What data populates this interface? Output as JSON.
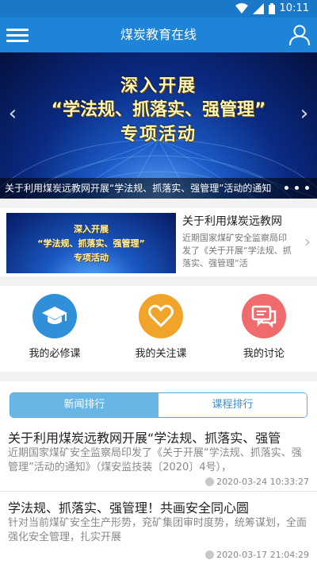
{
  "status": {
    "time": "10:11",
    "icons": [
      "wifi-icon",
      "signal-icon",
      "battery-icon"
    ]
  },
  "appbar": {
    "title": "煤炭教育在线",
    "menu_icon": "menu-icon",
    "user_icon": "user-icon"
  },
  "banner": {
    "line1": "深入开展",
    "line2": "“学法规、抓落实、强管理”",
    "line3": "专项活动",
    "caption": "关于利用煤炭远教网开展“学法规、抓落实、强管理”活动的通知",
    "prev_icon": "‹",
    "next_icon": "›"
  },
  "feature": {
    "thumb_line1": "深入开展",
    "thumb_line2": "“学法规、抓落实、强管理”",
    "thumb_line3": "专项活动",
    "title": "关于利用煤炭远教网",
    "summary": "近期国家煤矿安全监察局印发了《关于开展“学法规、抓落实、强管理”活",
    "chevron": "›"
  },
  "quick": [
    {
      "label": "我的必修课",
      "icon": "graduation-cap-icon",
      "color": "#2f8fd8"
    },
    {
      "label": "我的关注课",
      "icon": "heart-icon",
      "color": "#f0a52a"
    },
    {
      "label": "我的讨论",
      "icon": "chat-icon",
      "color": "#f06b6b"
    }
  ],
  "tabs": {
    "news": "新闻排行",
    "course": "课程排行"
  },
  "articles": [
    {
      "title": "关于利用煤炭远教网开展“学法规、抓落实、强管",
      "summary": "近期国家煤矿安全监察局印发了《关于开展“学法规、抓落实、强管理”活动的通知》（煤安监技装〔2020〕4号），",
      "date": "2020-03-24 10:33:27"
    },
    {
      "title": "学法规、抓落实、强管理！共画安全同心圆",
      "summary": "针对当前煤矿安全生产形势，兖矿集团审时度势，统筹谋划，全面强化安全管理，扎实开展",
      "date": "2020-03-17 21:04:29"
    }
  ]
}
